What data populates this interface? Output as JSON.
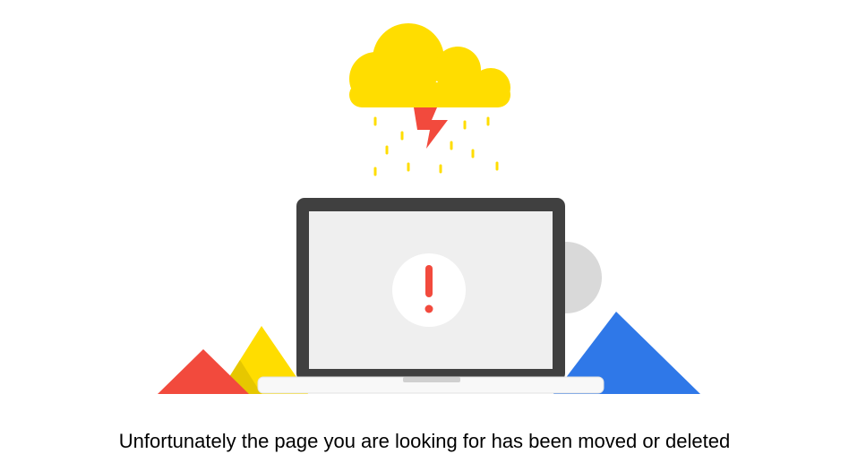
{
  "message": "Unfortunately the page you are looking for has been moved or deleted",
  "illustration": {
    "icons": [
      "storm-cloud-icon",
      "lightning-bolt-icon",
      "rain-drops",
      "laptop-icon",
      "exclamation-icon",
      "mountain-triangles"
    ],
    "colors": {
      "cloud": "#FFDD00",
      "lightning": "#F24A3D",
      "rain": "#FFDD00",
      "laptop_frame": "#404040",
      "laptop_screen": "#EFEFEF",
      "laptop_base": "#F8F8F8",
      "alert_circle": "#FFFFFF",
      "alert_mark": "#F24A3D",
      "triangle_red": "#F24A3D",
      "triangle_yellow": "#FFDD00",
      "triangle_blue": "#2F78E8",
      "circle_gray": "#D9D9D9"
    }
  }
}
